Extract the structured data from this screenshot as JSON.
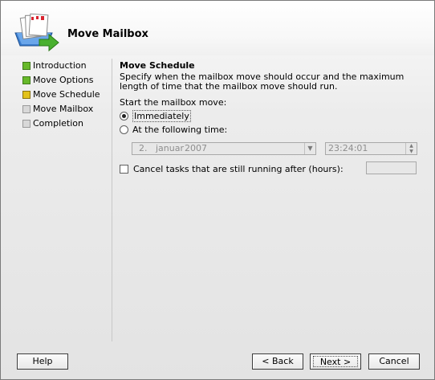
{
  "window": {
    "title": "Move Mailbox"
  },
  "steps": [
    {
      "label": "Introduction",
      "state": "done"
    },
    {
      "label": "Move Options",
      "state": "done"
    },
    {
      "label": "Move Schedule",
      "state": "current"
    },
    {
      "label": "Move Mailbox",
      "state": "pending"
    },
    {
      "label": "Completion",
      "state": "pending"
    }
  ],
  "schedule": {
    "title": "Move Schedule",
    "description": "Specify when the mailbox move should occur and the maximum length of time that the mailbox move should run.",
    "start_label": "Start the mailbox move:",
    "option_immediately": "Immediately",
    "option_at_time": "At the following time:",
    "selected_option": "Immediately",
    "date": {
      "day": "2.",
      "month": "januar",
      "year": "2007"
    },
    "time": "23:24:01",
    "cancel_tasks_label": "Cancel tasks that are still running after (hours):",
    "cancel_tasks_checked": false,
    "hours_value": ""
  },
  "buttons": {
    "help": "Help",
    "back": "< Back",
    "next": "Next >",
    "cancel": "Cancel"
  },
  "colors": {
    "step_done": "#67b92a",
    "step_current": "#e3c21b",
    "step_pending": "#d8d8d8"
  }
}
